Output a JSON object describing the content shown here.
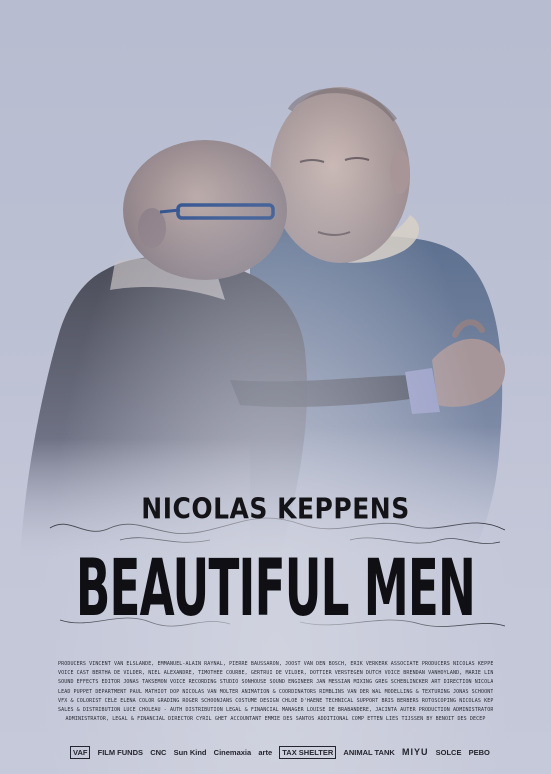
{
  "poster": {
    "director": "NICOLAS KEPPENS",
    "title": "BEAUTIFUL MEN",
    "credit_lines": [
      "producers VINCENT VAN ELSLANDE, EMMANUEL-ALAIN RAYNAL, PIERRE BAUSSARON, JOOST VAN DEN BOSCH, ERIK VERKERK   associate producers NICOLAS KEPPENS, VINCENT VAN ELSLANDE   line producer BERT LESAFFER   script translation ANGELO TIJSSENS",
      "voice cast BERTHA DE VILDER, NIEL ALEXANDRE, TIMOTHEE COURBE, GERTRUI DE VILDER, DOTTIER VERSTEGEN   dutch voice BRENDAN VANHOYLAND, MARIE LINET   music NICOLAS KEPPENS",
      "sound effects editor JONAS TAKSEMON   voice recording studio SONHOUSE   sound engineer JAN MESSIAN   mixing GREG SCHEBLINCKER   art direction NICOLAS KEPPENS   additional voices MATHY SAHL, LAURE VAN IMBRECHEL   puppets made by PEBO ANIMATION",
      "lead puppet department PAUL MATHIOT   dop NICOLAS VAN MOLTER   animation & coordinators RIMBLINS VAN DER WAL   modelling & texturing JONAS SCHOONTE, KATHRIN NOTTEBOHM   puppet painting NC STUDIO   editing XANDER FRITTERE   compositing MARIE LINET",
      "vfx & colorist CELE ELENA   color grading ROGER SCHOONJANS   costume design CHLOE D'HAENE   technical support BRIS BERBERS   rotoscoping NICOLAS KEPPENS   color grading JOACHIM VANVERDEGHT   postproduction VC STUDIO   subtitles BIB VANDENBULKE - DES AIRS PRODUCTIONS",
      "sales & distribution LUCE CHOLEAU - AUTH DISTRIBUTION   legal & financial manager LOUISE DE BRABANDERE, JACINTA AUTER   production administrator CONSTANCE LE SCHAUDEL",
      "administrator, legal & financial director CYRIL GHET   accountant EMMIE DES SANTOS   additional comp ETTEN LIES TIJSSEN BY BENOIT DES DECEP"
    ],
    "logos": [
      "VAF",
      "FILM FUNDS",
      "CNC",
      "Sun Kind",
      "Cinemaxia",
      "arte",
      "TAX SHELTER",
      "ANIMAL TANK",
      "MIYU",
      "SOLCE",
      "PEBO"
    ]
  }
}
